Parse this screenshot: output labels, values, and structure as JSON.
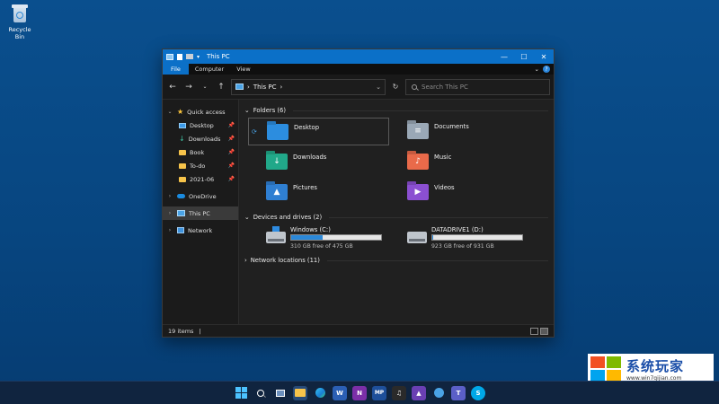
{
  "desktop": {
    "recycle_bin": "Recycle Bin"
  },
  "window": {
    "title": "This PC",
    "controls": {
      "minimize": "—",
      "maximize": "☐",
      "close": "✕"
    }
  },
  "ribbon": {
    "tabs": [
      {
        "label": "File"
      },
      {
        "label": "Computer"
      },
      {
        "label": "View"
      }
    ],
    "help": "?"
  },
  "navbar": {
    "address_path": "This PC",
    "search_placeholder": "Search This PC"
  },
  "sidebar": {
    "quick_access": "Quick access",
    "quick_items": [
      {
        "label": "Desktop"
      },
      {
        "label": "Downloads"
      },
      {
        "label": "Book"
      },
      {
        "label": "To-do"
      },
      {
        "label": "2021-06"
      }
    ],
    "onedrive": "OneDrive",
    "this_pc": "This PC",
    "network": "Network"
  },
  "main": {
    "folders_header": "Folders (6)",
    "folders": [
      {
        "label": "Desktop",
        "icon": "desktop-folder-icon"
      },
      {
        "label": "Documents",
        "icon": "documents-folder-icon"
      },
      {
        "label": "Downloads",
        "icon": "downloads-folder-icon"
      },
      {
        "label": "Music",
        "icon": "music-folder-icon"
      },
      {
        "label": "Pictures",
        "icon": "pictures-folder-icon"
      },
      {
        "label": "Videos",
        "icon": "videos-folder-icon"
      }
    ],
    "devices_header": "Devices and drives (2)",
    "drives": [
      {
        "name": "Windows  (C:)",
        "free": "310 GB free of 475 GB",
        "used_fraction": 0.35
      },
      {
        "name": "DATADRIVE1 (D:)",
        "free": "923 GB free of 931 GB",
        "used_fraction": 0.01
      }
    ],
    "network_header": "Network locations (11)"
  },
  "status": {
    "items": "19 items"
  },
  "taskbar": {
    "icons": [
      {
        "name": "start-icon",
        "text": ""
      },
      {
        "name": "search-icon",
        "text": ""
      },
      {
        "name": "task-view-icon",
        "text": ""
      },
      {
        "name": "file-explorer-icon",
        "text": ""
      },
      {
        "name": "edge-icon",
        "text": ""
      },
      {
        "name": "word-icon",
        "text": "W"
      },
      {
        "name": "onenote-icon",
        "text": "N"
      },
      {
        "name": "mp-icon",
        "text": "MP"
      },
      {
        "name": "audio-app-icon",
        "text": ""
      },
      {
        "name": "affinity-icon",
        "text": ""
      },
      {
        "name": "browser-icon",
        "text": ""
      },
      {
        "name": "teams-icon",
        "text": "T"
      },
      {
        "name": "skype-icon",
        "text": "S"
      }
    ]
  },
  "watermark": {
    "title": "系统玩家",
    "url": "www.win7qijian.com"
  },
  "colors": {
    "accent": "#0b70c8",
    "drive_fill": "#2b88d8"
  }
}
